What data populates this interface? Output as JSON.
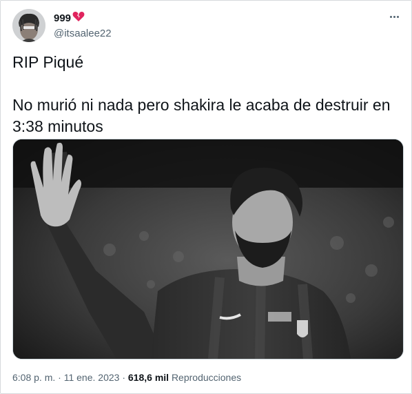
{
  "tweet": {
    "display_name": "999",
    "name_emoji": "broken-heart-icon",
    "handle": "@itsaalee22",
    "text": "RIP Piqué\n\nNo murió ni nada pero shakira le acaba de destruir en 3:38 minutos",
    "media_alt": "photo",
    "time": "6:08 p. m.",
    "separator": "·",
    "date": "11 ene. 2023",
    "views_count": "618,6 mil",
    "views_label": "Reproducciones"
  },
  "colors": {
    "text": "#0f1419",
    "secondary": "#536471",
    "heart": "#e0245e",
    "border": "#cfd9de"
  }
}
